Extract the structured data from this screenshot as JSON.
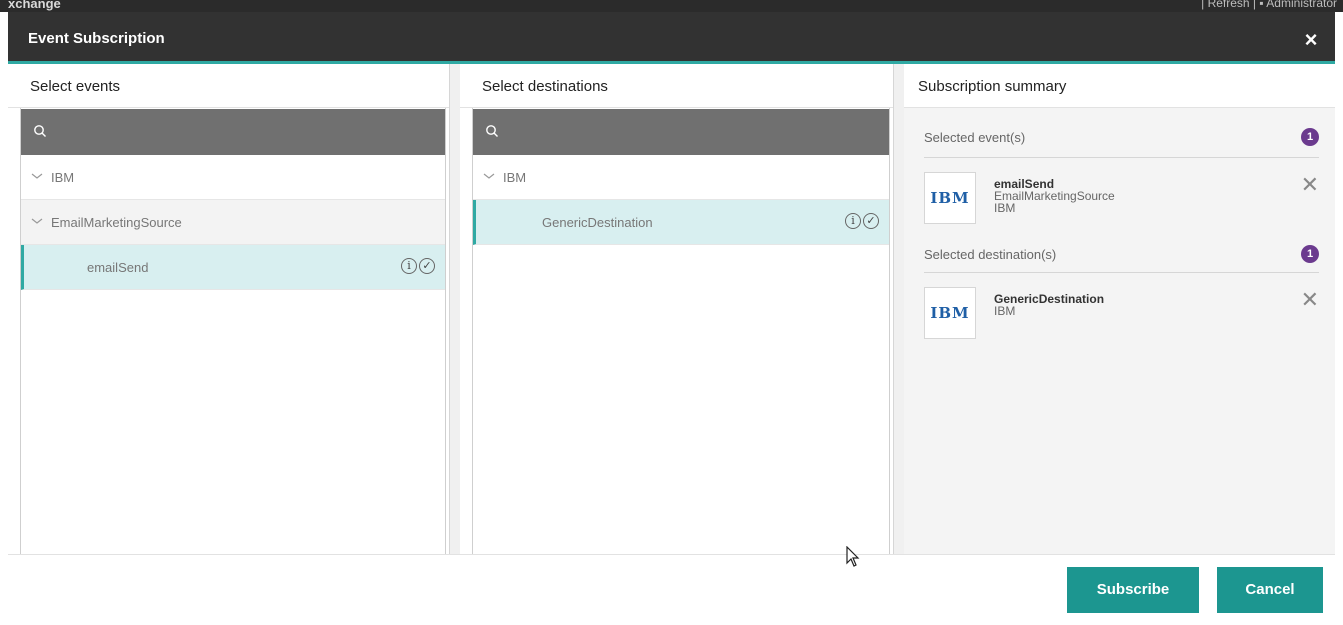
{
  "topbar": {
    "app_name": "xchange",
    "right_text": "|  Refresh  |  ▪  Administrator"
  },
  "dialog": {
    "title": "Event Subscription",
    "close_label": "×"
  },
  "events": {
    "heading": "Select events",
    "search_placeholder": "",
    "tree": [
      {
        "label": "IBM",
        "level": 0
      },
      {
        "label": "EmailMarketingSource",
        "level": 1
      },
      {
        "label": "emailSend",
        "level": 2,
        "selected": true
      }
    ]
  },
  "destinations": {
    "heading": "Select destinations",
    "search_placeholder": "",
    "tree": [
      {
        "label": "IBM",
        "level": 0
      },
      {
        "label": "GenericDestination",
        "level": 1,
        "selected": true
      }
    ]
  },
  "summary": {
    "heading": "Subscription summary",
    "events_label": "Selected event(s)",
    "events_count": "1",
    "event_item": {
      "logo": "IBM",
      "title": "emailSend",
      "line2": "EmailMarketingSource",
      "line3": "IBM"
    },
    "destinations_label": "Selected destination(s)",
    "destinations_count": "1",
    "destination_item": {
      "logo": "IBM",
      "title": "GenericDestination",
      "line2": "IBM"
    }
  },
  "footer": {
    "subscribe_label": "Subscribe",
    "cancel_label": "Cancel"
  },
  "colors": {
    "accent": "#2fa9a3",
    "button": "#1c9690",
    "badge": "#6b3a8e",
    "header": "#323232"
  },
  "icons": [
    "search-icon",
    "chevron-down-icon",
    "info-icon",
    "check-circle-icon",
    "close-icon",
    "remove-icon",
    "ibm-logo"
  ]
}
